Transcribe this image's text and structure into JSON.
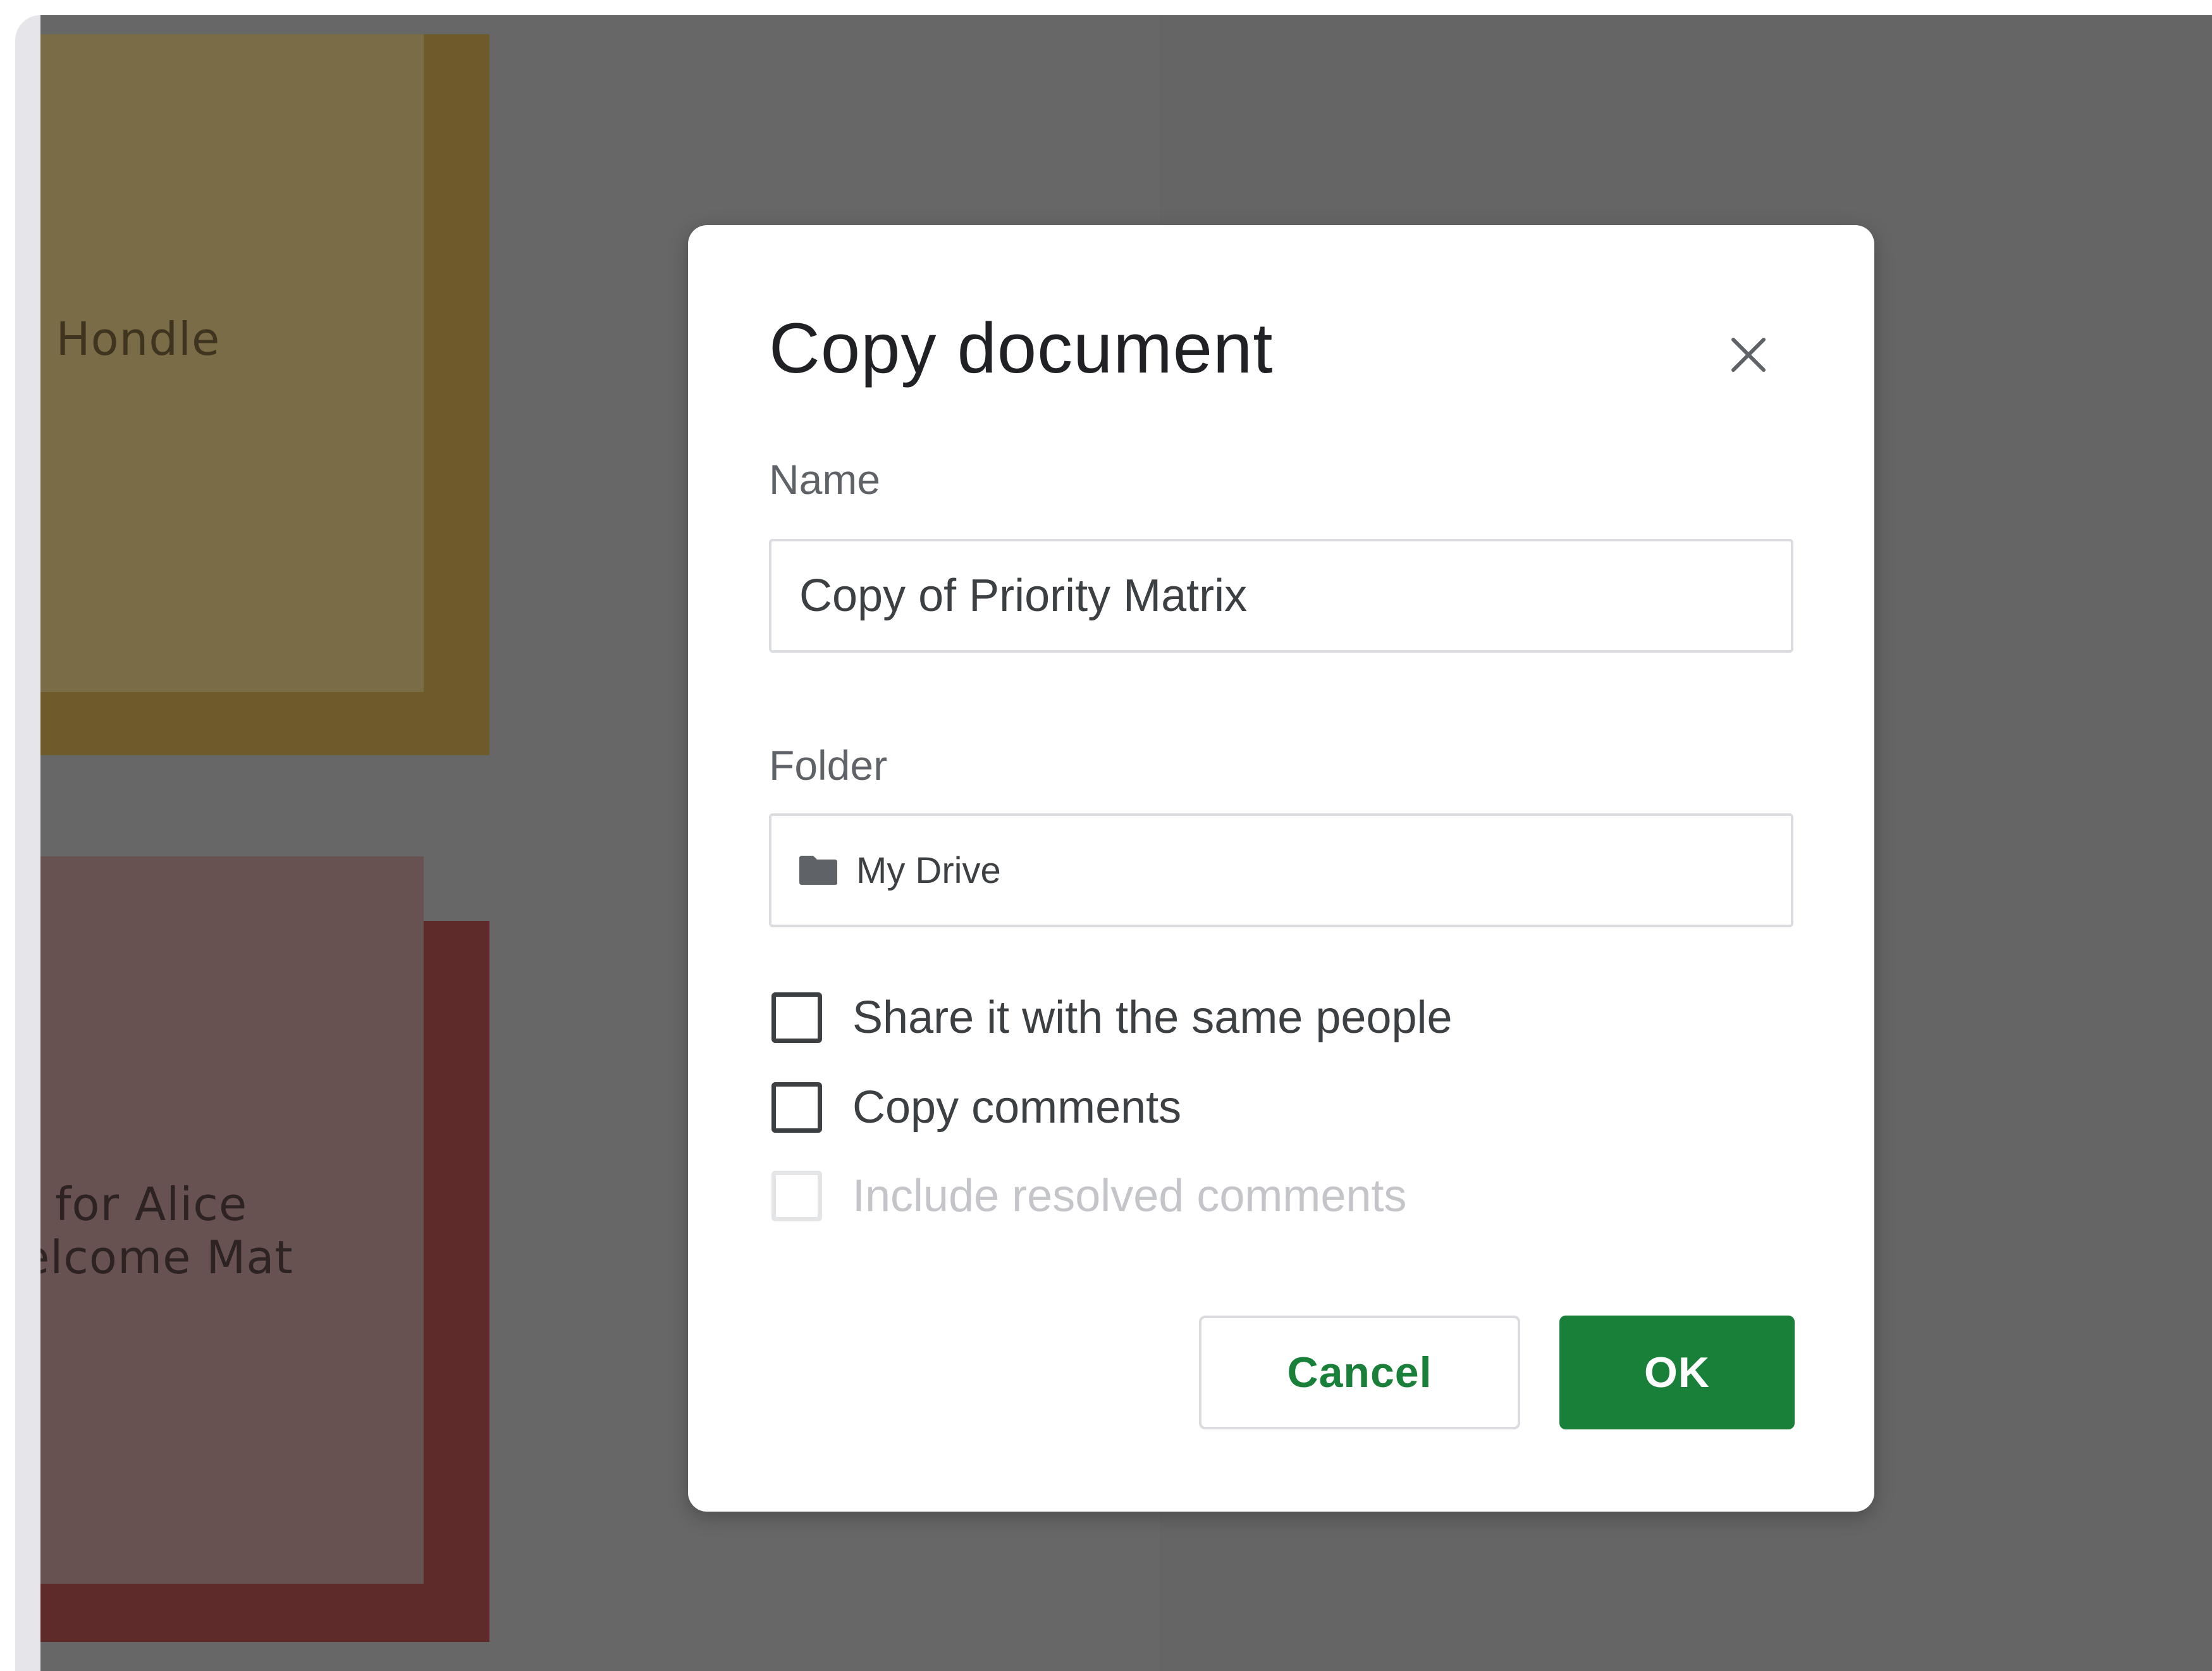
{
  "background": {
    "notes": [
      {
        "text": "r Hondle",
        "color": "#7a6c46"
      },
      {
        "text": "t for Alice\nelcome Mat",
        "color": "#685151"
      }
    ]
  },
  "dialog": {
    "title": "Copy document",
    "close_icon": "close-icon",
    "name_label": "Name",
    "name_value": "Copy of Priority Matrix",
    "folder_label": "Folder",
    "folder_icon": "folder-icon",
    "folder_value": "My Drive",
    "options": [
      {
        "label": "Share it with the same people",
        "checked": false,
        "disabled": false
      },
      {
        "label": "Copy comments",
        "checked": false,
        "disabled": false
      },
      {
        "label": "Include resolved comments",
        "checked": false,
        "disabled": true
      }
    ],
    "cancel_label": "Cancel",
    "ok_label": "OK",
    "accent_color": "#188038"
  }
}
